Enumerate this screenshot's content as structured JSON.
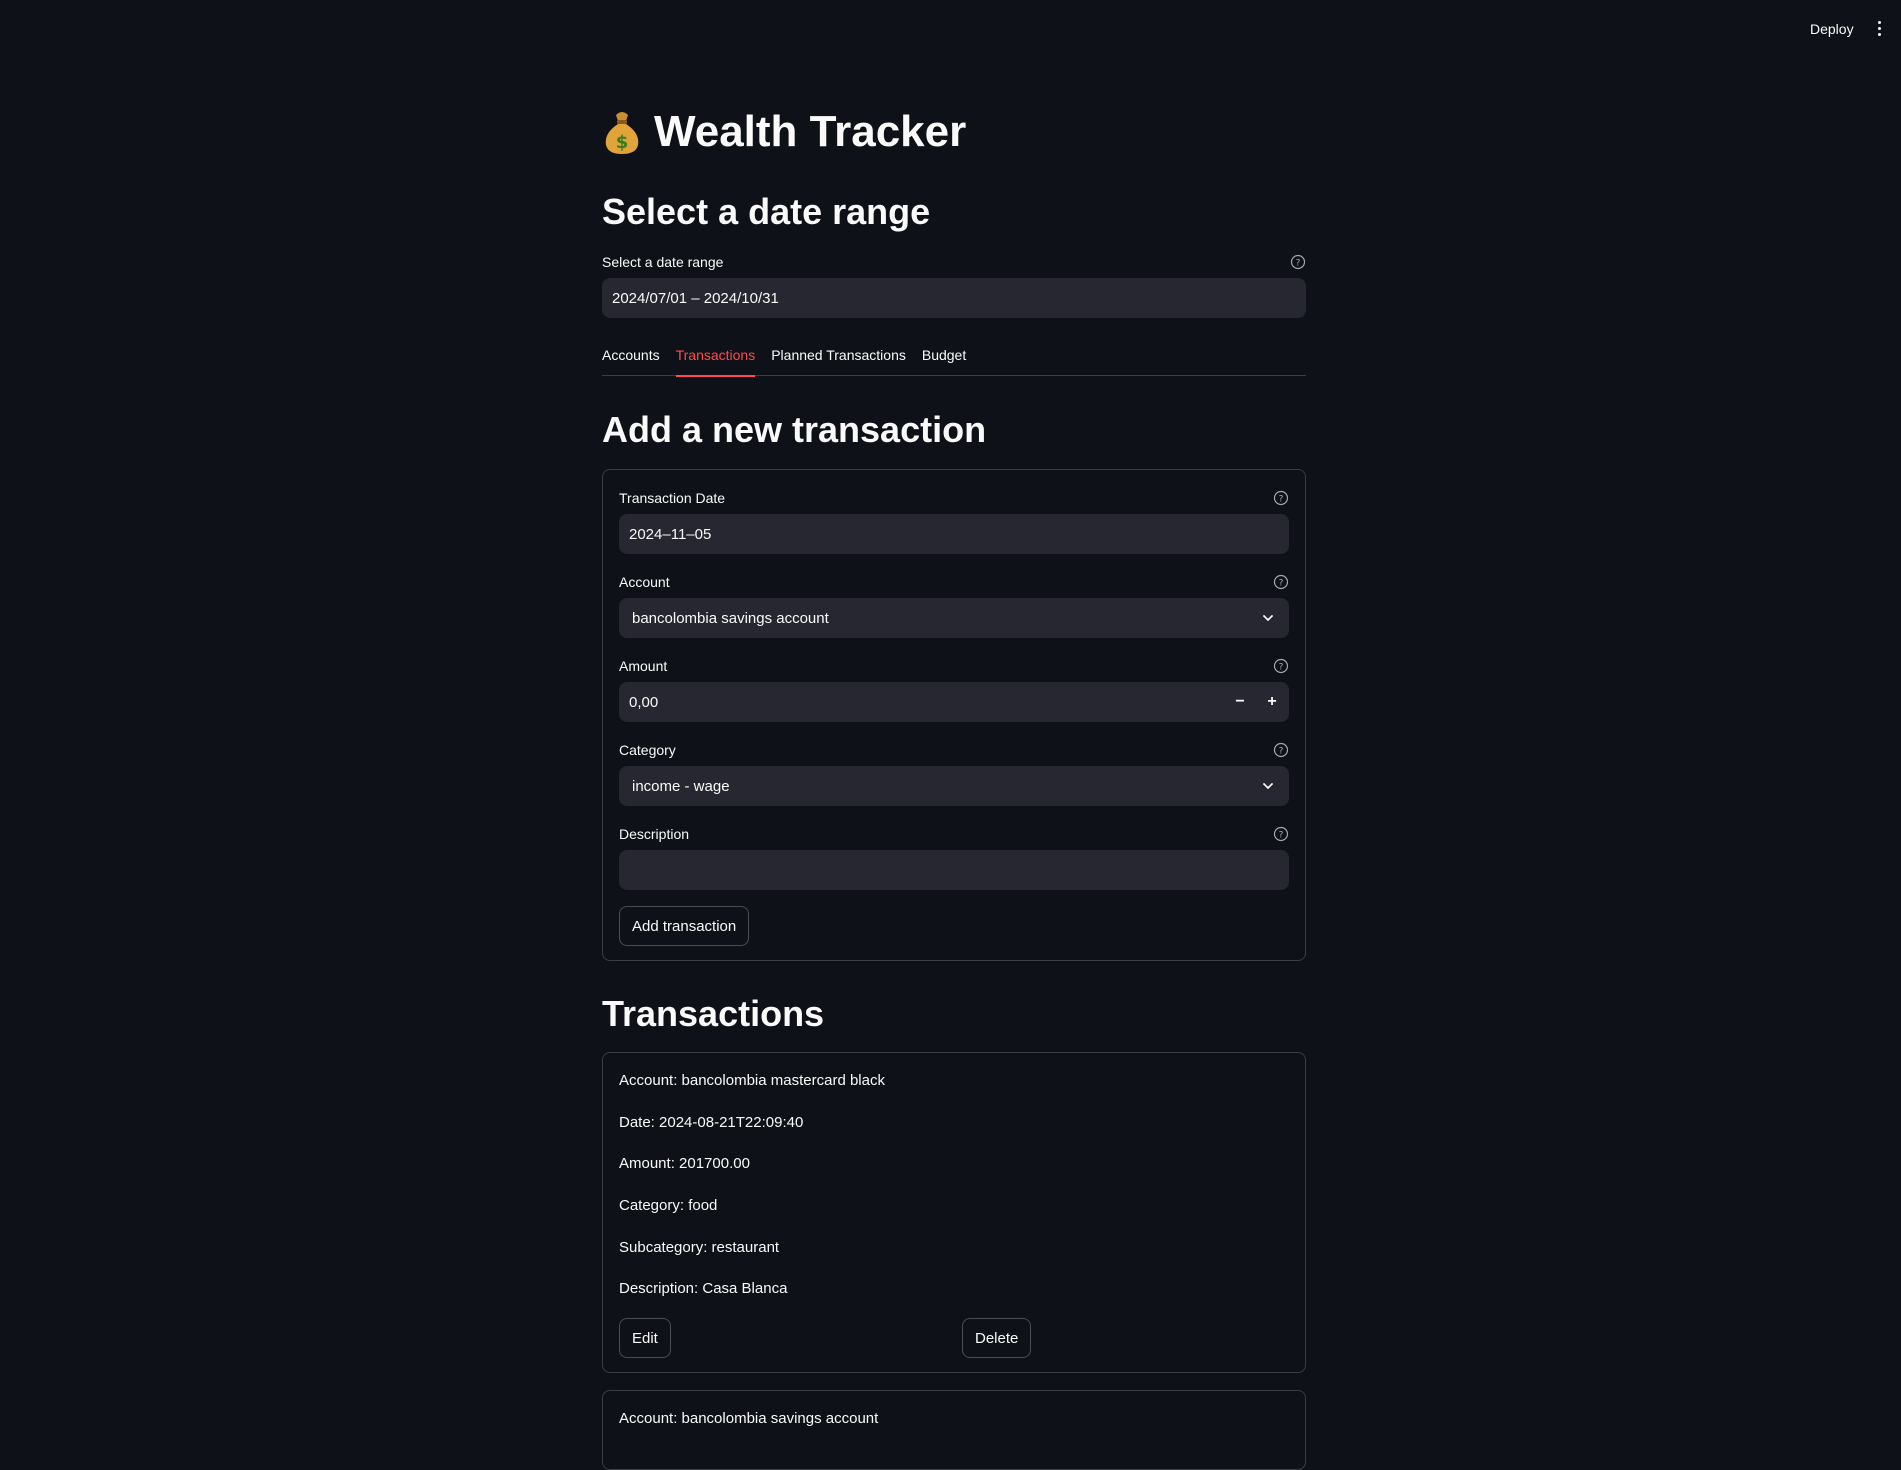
{
  "header": {
    "deploy_label": "Deploy",
    "menu_icon": "more-vertical-icon"
  },
  "app": {
    "title": "Wealth Tracker",
    "title_icon": "money-bag-icon"
  },
  "date_range_section": {
    "heading": "Select a date range",
    "label": "Select a date range",
    "value": "2024/07/01 – 2024/10/31"
  },
  "tabs": [
    {
      "label": "Accounts",
      "active": false
    },
    {
      "label": "Transactions",
      "active": true
    },
    {
      "label": "Planned Transactions",
      "active": false
    },
    {
      "label": "Budget",
      "active": false
    }
  ],
  "form": {
    "heading": "Add a new transaction",
    "date_label": "Transaction Date",
    "date_value": "2024–11–05",
    "account_label": "Account",
    "account_value": "bancolombia savings account",
    "amount_label": "Amount",
    "amount_value": "0,00",
    "amount_minus": "−",
    "amount_plus": "+",
    "category_label": "Category",
    "category_value": "income - wage",
    "description_label": "Description",
    "description_value": "",
    "submit_label": "Add transaction"
  },
  "transactions": {
    "heading": "Transactions",
    "items": [
      {
        "account": "Account: bancolombia mastercard black",
        "date": "Date: 2024-08-21T22:09:40",
        "amount": "Amount: 201700.00",
        "category": "Category: food",
        "subcategory": "Subcategory: restaurant",
        "description": "Description: Casa Blanca",
        "edit_label": "Edit",
        "delete_label": "Delete"
      },
      {
        "account": "Account: bancolombia savings account"
      }
    ]
  },
  "colors": {
    "background": "#0e1117",
    "input_bg": "#262730",
    "accent": "#ff4b4b",
    "text": "#fafafa"
  }
}
